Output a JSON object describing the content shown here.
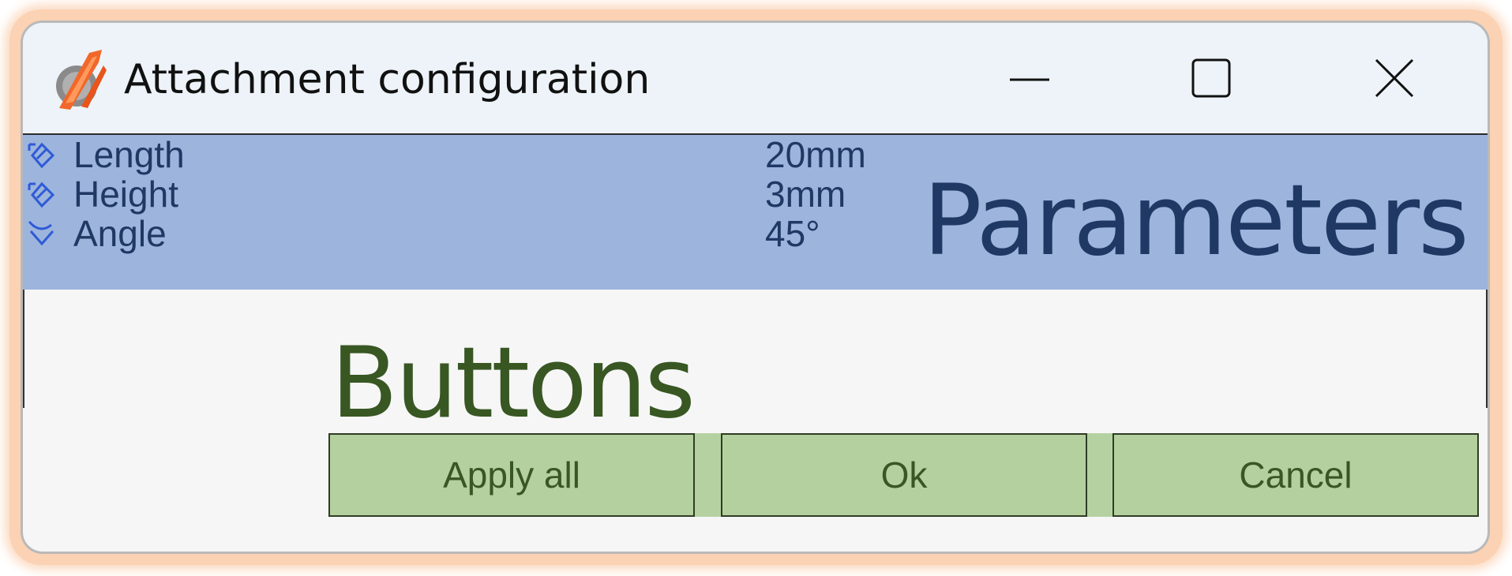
{
  "window": {
    "title": "Attachment configuration",
    "controls": {
      "minimize": "minimize-icon",
      "maximize": "maximize-icon",
      "close": "close-icon"
    }
  },
  "parameters": {
    "label": "Parameters",
    "rows": [
      {
        "name": "Length",
        "value": "20mm",
        "icon": "linear-dimension-icon"
      },
      {
        "name": "Height",
        "value": "3mm",
        "icon": "linear-dimension-icon"
      },
      {
        "name": "Angle",
        "value": "45°",
        "icon": "angle-dimension-icon"
      }
    ]
  },
  "buttons": {
    "label": "Buttons",
    "apply_all": "Apply all",
    "ok": "Ok",
    "cancel": "Cancel"
  },
  "colors": {
    "parameters_bg": "#9db4dd",
    "parameters_text": "#1f3864",
    "buttons_bg": "#b4d09f",
    "buttons_text": "#385723",
    "outer_glow": "#fbd2b3"
  }
}
